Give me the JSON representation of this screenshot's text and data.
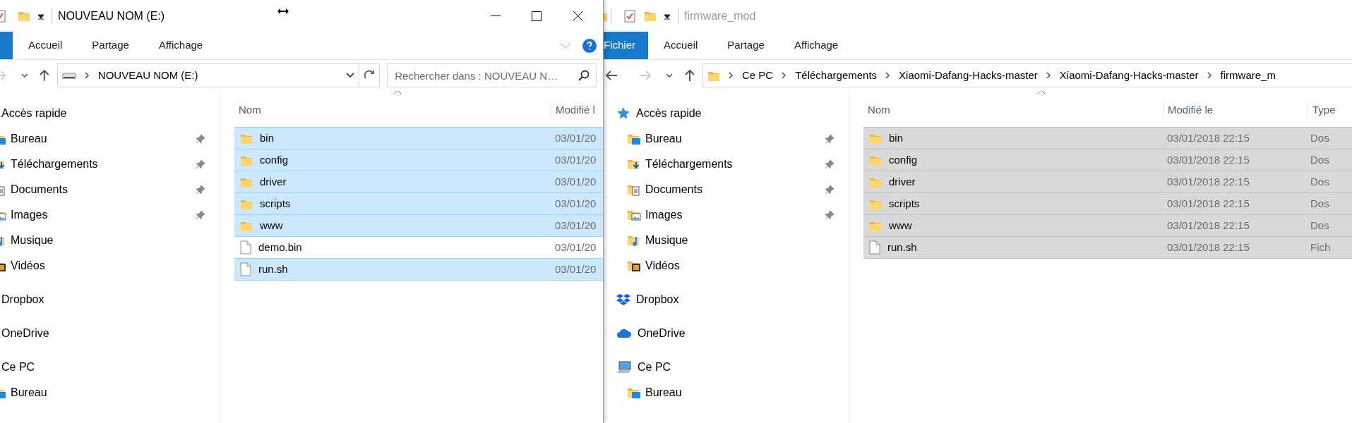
{
  "left_window": {
    "title": "NOUVEAU NOM (E:)",
    "active": true,
    "ribbon_tabs": [
      {
        "label": "Accueil",
        "kind": "tab"
      },
      {
        "label": "Partage",
        "kind": "tab"
      },
      {
        "label": "Affichage",
        "kind": "tab"
      }
    ],
    "address": [
      "NOUVEAU NOM (E:)"
    ],
    "search": {
      "placeholder": "Rechercher dans : NOUVEAU N…"
    },
    "nav": [
      {
        "label": "Accès rapide",
        "kind": "quick-access",
        "pinned": false
      },
      {
        "label": "Bureau",
        "kind": "desktop",
        "pinned": true
      },
      {
        "label": "Téléchargements",
        "kind": "downloads",
        "pinned": true
      },
      {
        "label": "Documents",
        "kind": "documents",
        "pinned": true
      },
      {
        "label": "Images",
        "kind": "pictures",
        "pinned": true
      },
      {
        "label": "Musique",
        "kind": "music",
        "pinned": false
      },
      {
        "label": "Vidéos",
        "kind": "videos",
        "pinned": false
      },
      {
        "label": "Dropbox",
        "kind": "dropbox",
        "pinned": false
      },
      {
        "label": "OneDrive",
        "kind": "onedrive",
        "pinned": false
      },
      {
        "label": "Ce PC",
        "kind": "pc",
        "pinned": false
      },
      {
        "label": "Bureau",
        "kind": "desktop",
        "pinned": false
      }
    ],
    "columns": [
      "Nom",
      "Modifié l"
    ],
    "files": [
      {
        "name": "bin",
        "kind": "folder",
        "selected": true,
        "modified": "03/01/20"
      },
      {
        "name": "config",
        "kind": "folder",
        "selected": true,
        "modified": "03/01/20"
      },
      {
        "name": "driver",
        "kind": "folder",
        "selected": true,
        "modified": "03/01/20"
      },
      {
        "name": "scripts",
        "kind": "folder",
        "selected": true,
        "modified": "03/01/20"
      },
      {
        "name": "www",
        "kind": "folder",
        "selected": true,
        "modified": "03/01/20"
      },
      {
        "name": "demo.bin",
        "kind": "file",
        "selected": false,
        "modified": "03/01/20"
      },
      {
        "name": "run.sh",
        "kind": "file",
        "selected": true,
        "modified": "03/01/20"
      }
    ]
  },
  "right_window": {
    "title": "firmware_mod",
    "active": false,
    "ribbon_tabs": [
      {
        "label": "Fichier",
        "kind": "file"
      },
      {
        "label": "Accueil",
        "kind": "tab"
      },
      {
        "label": "Partage",
        "kind": "tab"
      },
      {
        "label": "Affichage",
        "kind": "tab"
      }
    ],
    "address": [
      "Ce PC",
      "Téléchargements",
      "Xiaomi-Dafang-Hacks-master",
      "Xiaomi-Dafang-Hacks-master",
      "firmware_m"
    ],
    "nav": [
      {
        "label": "Accès rapide",
        "kind": "quick-access",
        "pinned": false
      },
      {
        "label": "Bureau",
        "kind": "desktop",
        "pinned": true
      },
      {
        "label": "Téléchargements",
        "kind": "downloads",
        "pinned": true
      },
      {
        "label": "Documents",
        "kind": "documents",
        "pinned": true
      },
      {
        "label": "Images",
        "kind": "pictures",
        "pinned": true
      },
      {
        "label": "Musique",
        "kind": "music",
        "pinned": false
      },
      {
        "label": "Vidéos",
        "kind": "videos",
        "pinned": false
      },
      {
        "label": "Dropbox",
        "kind": "dropbox",
        "pinned": false
      },
      {
        "label": "OneDrive",
        "kind": "onedrive",
        "pinned": false
      },
      {
        "label": "Ce PC",
        "kind": "pc",
        "pinned": false
      },
      {
        "label": "Bureau",
        "kind": "desktop",
        "pinned": false
      }
    ],
    "columns": [
      "Nom",
      "Modifié le",
      "Type"
    ],
    "files": [
      {
        "name": "bin",
        "kind": "folder",
        "selected": true,
        "modified": "03/01/2018 22:15",
        "type": "Dos"
      },
      {
        "name": "config",
        "kind": "folder",
        "selected": true,
        "modified": "03/01/2018 22:15",
        "type": "Dos"
      },
      {
        "name": "driver",
        "kind": "folder",
        "selected": true,
        "modified": "03/01/2018 22:15",
        "type": "Dos"
      },
      {
        "name": "scripts",
        "kind": "folder",
        "selected": true,
        "modified": "03/01/2018 22:15",
        "type": "Dos"
      },
      {
        "name": "www",
        "kind": "folder",
        "selected": true,
        "modified": "03/01/2018 22:15",
        "type": "Dos"
      },
      {
        "name": "run.sh",
        "kind": "file",
        "selected": true,
        "modified": "03/01/2018 22:15",
        "type": "Fich"
      }
    ]
  }
}
